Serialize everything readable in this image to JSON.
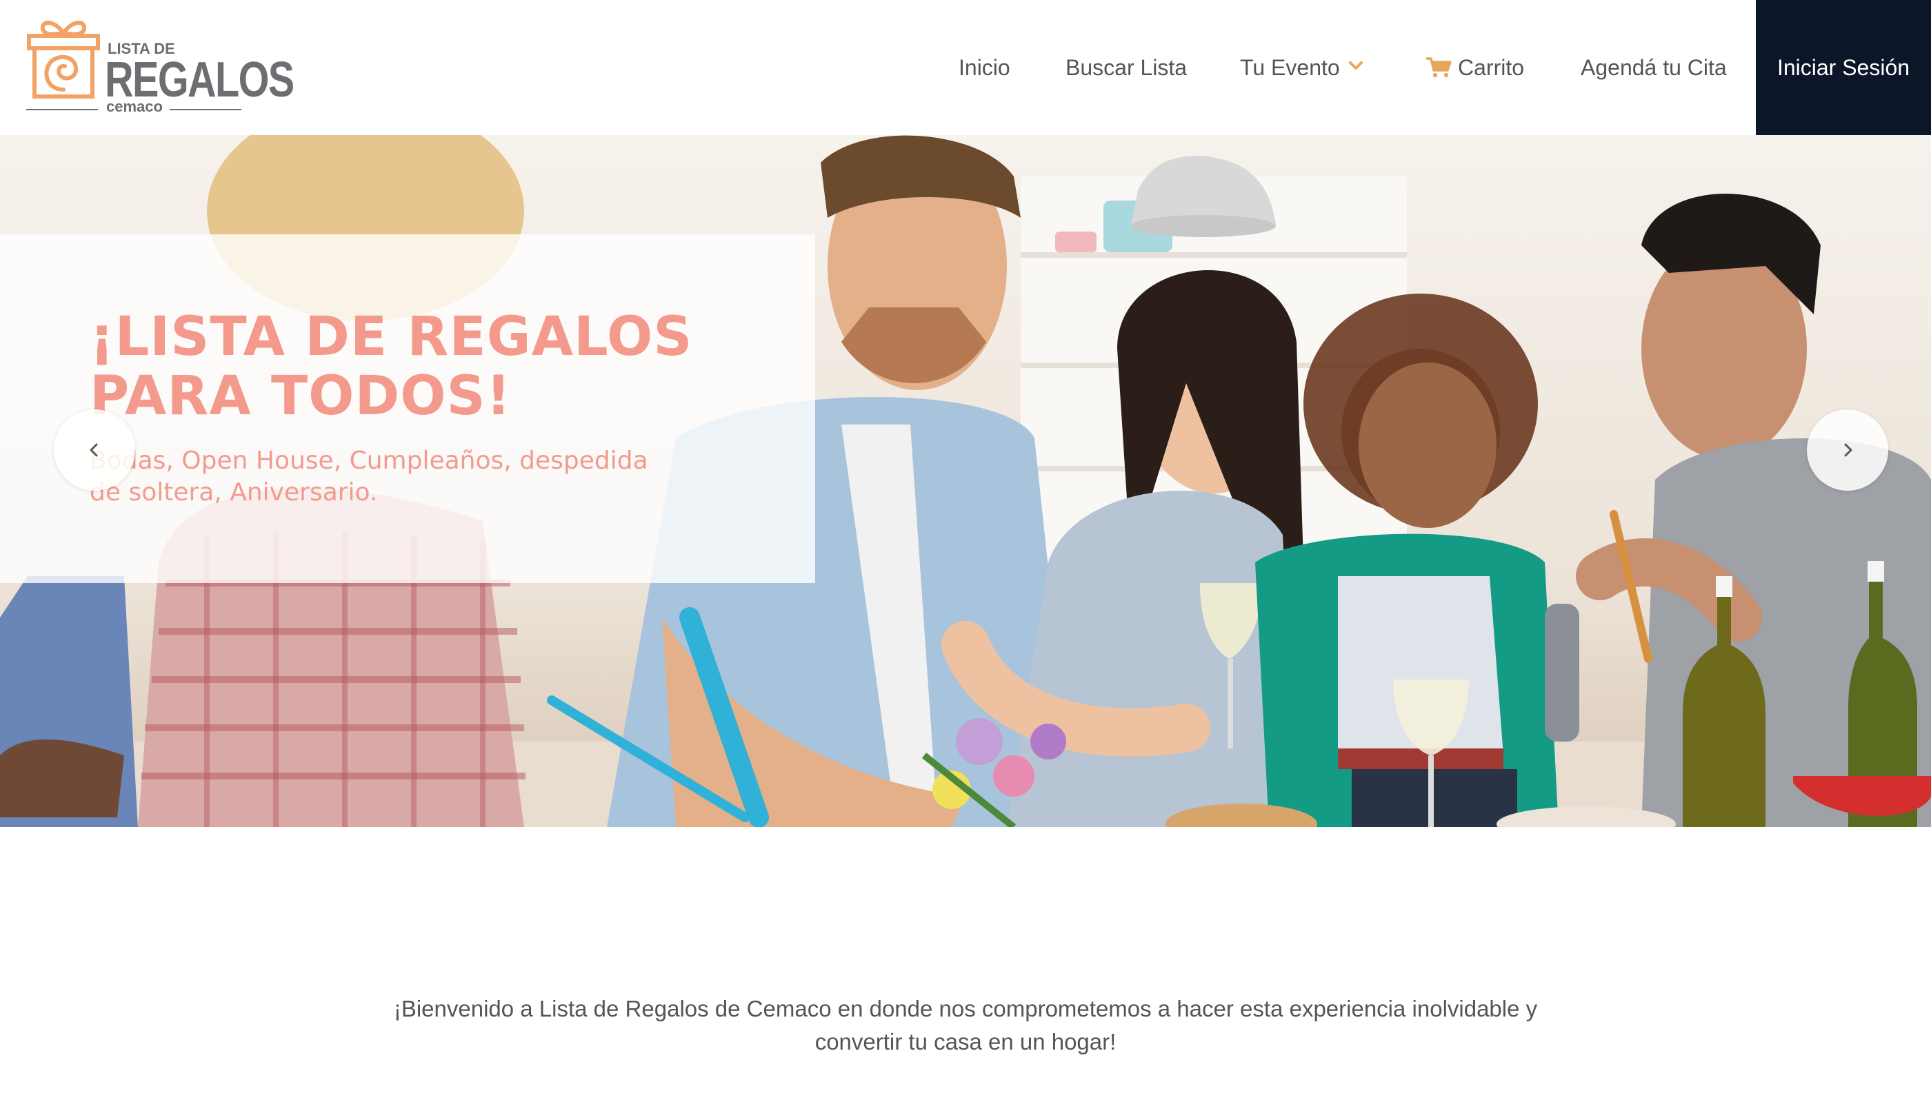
{
  "logo": {
    "small_text": "LISTA DE",
    "big_text": "REGALOS",
    "brand": "cemaco",
    "color": "#6d6e71",
    "gift_color": "#f3a266"
  },
  "nav": {
    "items": [
      {
        "label": "Inicio"
      },
      {
        "label": "Buscar Lista"
      },
      {
        "label": "Tu Evento",
        "icon": "chevron-down-icon"
      },
      {
        "label": "Carrito",
        "icon": "cart-icon"
      },
      {
        "label": "Agendá tu Cita"
      }
    ],
    "login_label": "Iniciar Sesión",
    "accent_color": "#e8a65c",
    "login_bg": "#0b1629"
  },
  "hero": {
    "title": "¡LISTA DE REGALOS PARA TODOS!",
    "subtitle": "Bodas, Open House, Cumpleaños, despedida de soltera, Aniversario.",
    "title_color": "#f39a8d",
    "prev_icon": "chevron-left-icon",
    "next_icon": "chevron-right-icon"
  },
  "welcome": {
    "text": "¡Bienvenido a Lista de Regalos de Cemaco en donde nos comprometemos a hacer esta experiencia inolvidable y convertir tu casa en un hogar!"
  }
}
